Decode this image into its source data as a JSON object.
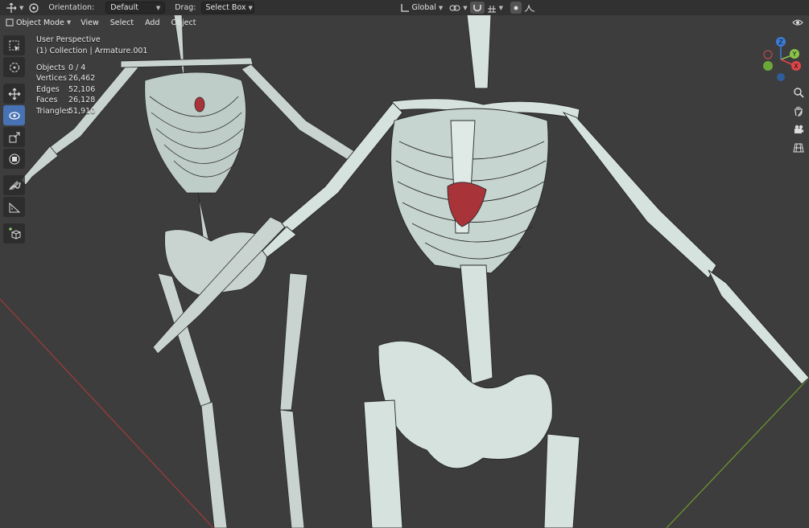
{
  "header": {
    "editor_type_icon": "move-gizmo-icon",
    "orientation_label": "Orientation:",
    "orientation_value": "Default",
    "drag_label": "Drag:",
    "drag_value": "Select Box",
    "transform_orientation": "Global"
  },
  "subheader": {
    "mode": "Object Mode",
    "menus": [
      "View",
      "Select",
      "Add",
      "Object"
    ]
  },
  "viewport": {
    "view_name": "User Perspective",
    "collection": "(1) Collection | Armature.001",
    "stats": [
      {
        "label": "Objects",
        "value": "0 / 4"
      },
      {
        "label": "Vertices",
        "value": "26,462"
      },
      {
        "label": "Edges",
        "value": "52,106"
      },
      {
        "label": "Faces",
        "value": "26,128"
      },
      {
        "label": "Triangles",
        "value": "51,910"
      }
    ],
    "background_color": "#3d3d3d",
    "x_axis_color": "#a33a3a",
    "y_axis_color": "#6e9b2c"
  },
  "gizmo": {
    "x": "X",
    "y": "Y",
    "z": "Z"
  },
  "toolbar": {
    "tools": [
      "select-box-icon",
      "cursor-icon",
      "move-icon",
      "rotate-icon",
      "scale-icon",
      "transform-icon",
      "annotate-icon",
      "measure-icon",
      "add-cube-icon"
    ],
    "active": "rotate-icon"
  }
}
